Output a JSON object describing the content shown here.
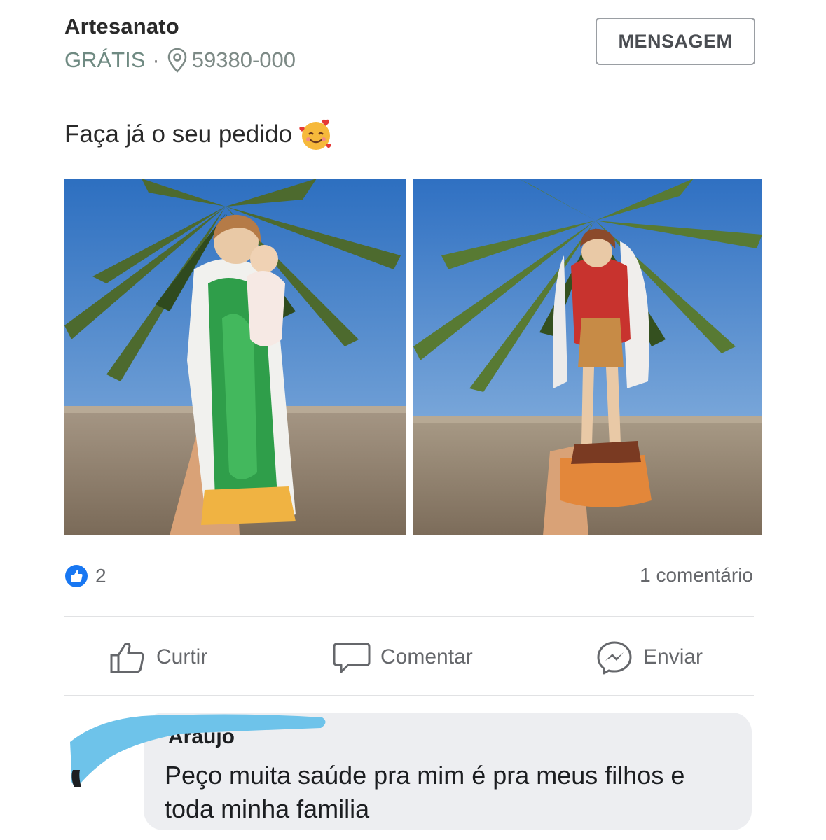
{
  "listing": {
    "title": "Artesanato",
    "price": "GRÁTIS",
    "separator": "·",
    "postal_code": "59380-000",
    "message_button": "MENSAGEM"
  },
  "post": {
    "text": "Faça já o seu pedido",
    "emoji": "smiling-face-with-hearts-icon"
  },
  "photos": [
    {
      "subject": "statue-green-robe-holding-child"
    },
    {
      "subject": "statue-winged-red-cape"
    }
  ],
  "stats": {
    "likes": "2",
    "comments": "1 comentário"
  },
  "actions": {
    "like": "Curtir",
    "comment": "Comentar",
    "send": "Enviar"
  },
  "comment": {
    "author": "Araujo",
    "text": "Peço  muita saúde  pra mim é pra meus filhos e toda minha familia"
  },
  "colors": {
    "like_blue": "#1877f2",
    "censor_blue": "#6ec3ea",
    "bubble": "#edeef1"
  }
}
